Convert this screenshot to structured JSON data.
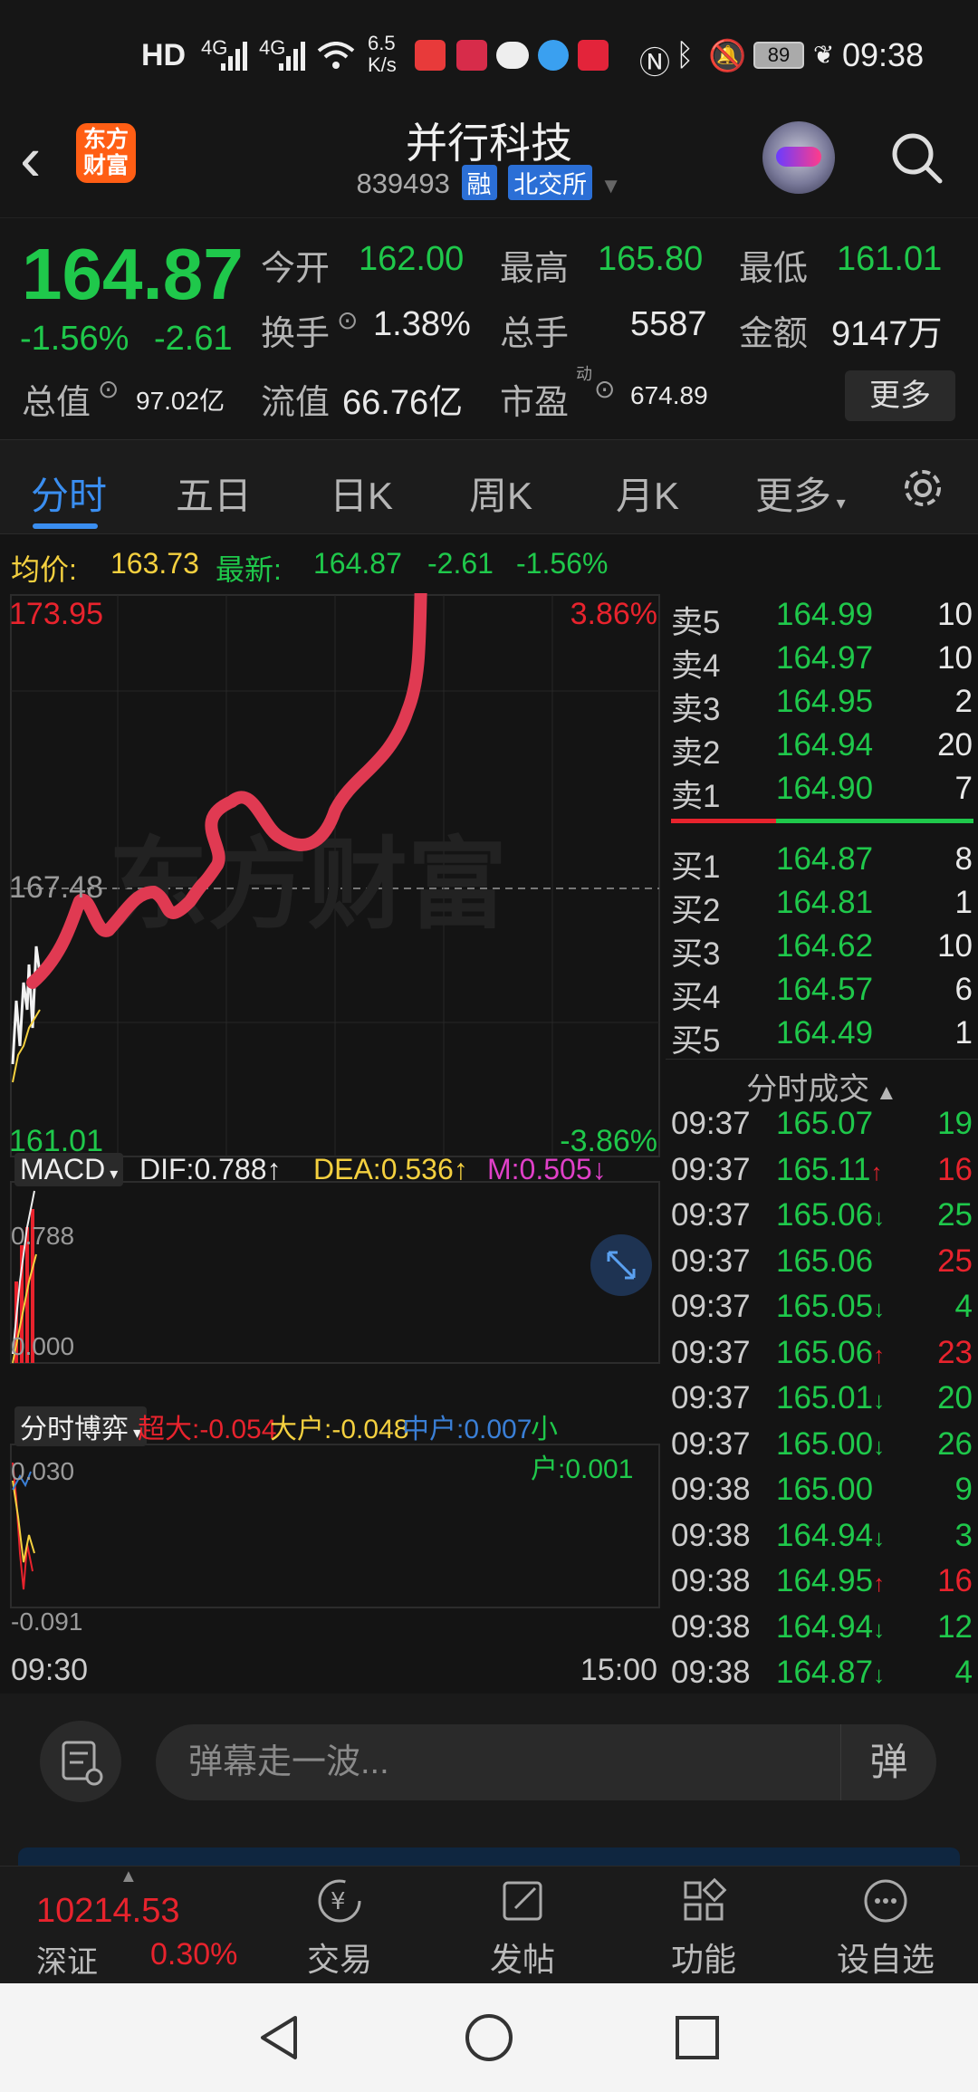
{
  "status_bar": {
    "hd": "HD",
    "net1": "4G",
    "net2": "4G",
    "speed": "6.5",
    "speed_unit": "K/s",
    "battery": "89",
    "time": "09:38"
  },
  "header": {
    "logo_text_1": "东方",
    "logo_text_2": "财富",
    "title": "并行科技",
    "code": "839493",
    "tag_margin": "融",
    "tag_exchange": "北交所"
  },
  "quote": {
    "price": "164.87",
    "change_pct": "-1.56%",
    "change_abs": "-2.61",
    "open_label": "今开",
    "open_value": "162.00",
    "high_label": "最高",
    "high_value": "165.80",
    "low_label": "最低",
    "low_value": "161.01",
    "turnover_label": "换手",
    "turnover_value": "1.38%",
    "volume_label": "总手",
    "volume_value": "5587",
    "amount_label": "金额",
    "amount_value": "9147万",
    "mktcap_label": "总值",
    "mktcap_value": "97.02亿",
    "float_label": "流值",
    "float_value": "66.76亿",
    "pe_label": "市盈",
    "pe_sup": "动",
    "pe_value": "674.89",
    "more_label": "更多"
  },
  "tabs": {
    "items": [
      "分时",
      "五日",
      "日K",
      "周K",
      "月K",
      "更多"
    ],
    "active": "分时"
  },
  "avg_row": {
    "avg_label": "均价:",
    "avg_value": "163.73",
    "latest_label": "最新:",
    "latest_value": "164.87",
    "latest_change": "-2.61",
    "latest_pct": "-1.56%"
  },
  "chart_data": {
    "type": "line",
    "title": "",
    "watermark": "东方财富",
    "y_top_label": "173.95",
    "y_top_pct": "3.86%",
    "y_mid_label": "167.48",
    "y_bottom_label": "161.01",
    "y_bottom_pct": "-3.86%",
    "ylim": [
      161.01,
      173.95
    ],
    "x_start": "09:30",
    "x_end": "15:00",
    "macd": {
      "selector": "MACD",
      "dif": "DIF:0.788↑",
      "dea": "DEA:0.536↑",
      "m": "M:0.505↓",
      "top": "0.788",
      "bottom": "0.000"
    },
    "bobo": {
      "selector": "分时博弈",
      "super": "超大:-0.054",
      "big": "大户:-0.048",
      "mid": "中户:0.007",
      "small": "小户:0.001",
      "top": "0.030",
      "bottom": "-0.091"
    }
  },
  "order_book": {
    "asks": [
      {
        "label": "卖5",
        "price": "164.99",
        "vol": "10"
      },
      {
        "label": "卖4",
        "price": "164.97",
        "vol": "10"
      },
      {
        "label": "卖3",
        "price": "164.95",
        "vol": "2"
      },
      {
        "label": "卖2",
        "price": "164.94",
        "vol": "20"
      },
      {
        "label": "卖1",
        "price": "164.90",
        "vol": "7"
      }
    ],
    "bids": [
      {
        "label": "买1",
        "price": "164.87",
        "vol": "8"
      },
      {
        "label": "买2",
        "price": "164.81",
        "vol": "1"
      },
      {
        "label": "买3",
        "price": "164.62",
        "vol": "10"
      },
      {
        "label": "买4",
        "price": "164.57",
        "vol": "6"
      },
      {
        "label": "买5",
        "price": "164.49",
        "vol": "1"
      }
    ],
    "ticks_title": "分时成交",
    "ticks": [
      {
        "time": "09:37",
        "price": "165.07",
        "arrow": "",
        "vol": "19",
        "vcolor": "green"
      },
      {
        "time": "09:37",
        "price": "165.11",
        "arrow": "↑",
        "vol": "16",
        "vcolor": "red"
      },
      {
        "time": "09:37",
        "price": "165.06",
        "arrow": "↓",
        "vol": "25",
        "vcolor": "green"
      },
      {
        "time": "09:37",
        "price": "165.06",
        "arrow": "",
        "vol": "25",
        "vcolor": "red"
      },
      {
        "time": "09:37",
        "price": "165.05",
        "arrow": "↓",
        "vol": "4",
        "vcolor": "green"
      },
      {
        "time": "09:37",
        "price": "165.06",
        "arrow": "↑",
        "vol": "23",
        "vcolor": "red"
      },
      {
        "time": "09:37",
        "price": "165.01",
        "arrow": "↓",
        "vol": "20",
        "vcolor": "green"
      },
      {
        "time": "09:37",
        "price": "165.00",
        "arrow": "↓",
        "vol": "26",
        "vcolor": "green"
      },
      {
        "time": "09:38",
        "price": "165.00",
        "arrow": "",
        "vol": "9",
        "vcolor": "green"
      },
      {
        "time": "09:38",
        "price": "164.94",
        "arrow": "↓",
        "vol": "3",
        "vcolor": "green"
      },
      {
        "time": "09:38",
        "price": "164.95",
        "arrow": "↑",
        "vol": "16",
        "vcolor": "red"
      },
      {
        "time": "09:38",
        "price": "164.94",
        "arrow": "↓",
        "vol": "12",
        "vcolor": "green"
      },
      {
        "time": "09:38",
        "price": "164.87",
        "arrow": "↓",
        "vol": "4",
        "vcolor": "green"
      }
    ]
  },
  "danmu": {
    "placeholder": "弹幕走一波...",
    "send_label": "弹"
  },
  "bottom_bar": {
    "index_value": "10214.53",
    "index_name": "深证",
    "index_pct": "0.30%",
    "items": [
      "交易",
      "发帖",
      "功能",
      "设自选"
    ]
  },
  "colors": {
    "up": "#e8232d",
    "down": "#1fc84b",
    "accent": "#3a8ef0",
    "annotation": "#e03a52"
  }
}
